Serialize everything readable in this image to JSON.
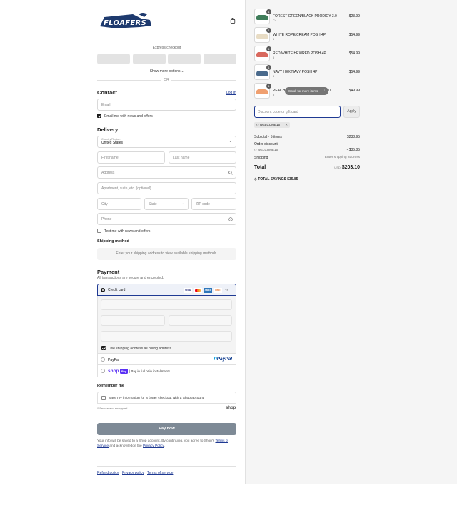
{
  "brand": {
    "name": "FLOAFERS"
  },
  "express": {
    "label": "Express checkout",
    "show_more": "Show more options",
    "or": "OR"
  },
  "contact": {
    "title": "Contact",
    "login": "Log in",
    "email_placeholder": "Email",
    "email_news": "Email me with news and offers"
  },
  "delivery": {
    "title": "Delivery",
    "country_label": "Country/Region",
    "country_value": "United States",
    "first_name": "First name",
    "last_name": "Last name",
    "address": "Address",
    "apartment": "Apartment, suite, etc. (optional)",
    "city": "City",
    "state": "State",
    "zip": "ZIP code",
    "phone": "Phone",
    "text_news": "Text me with news and offers"
  },
  "shipping": {
    "title": "Shipping method",
    "message": "Enter your shipping address to view available shipping methods."
  },
  "payment": {
    "title": "Payment",
    "subtitle": "All transactions are secure and encrypted.",
    "credit_card": "Credit card",
    "card_brands": [
      "VISA",
      "MC",
      "AMEX",
      "DISC"
    ],
    "more_brands": "+4",
    "billing_same": "Use shipping address as billing address",
    "paypal": "PayPal",
    "paypal_logo": "PayPal",
    "shoppay_logo": "shop",
    "shoppay_badge": "Pay",
    "shoppay_text": "| Pay in full or in installments"
  },
  "remember": {
    "title": "Remember me",
    "save_info": "Save my information for a faster checkout with a Shop account",
    "secure": "Secure and encrypted",
    "shop": "shop"
  },
  "pay_now": "Pay now",
  "legal": {
    "prefix": "Your info will be saved to a Shop account. By continuing, you agree to Shop's ",
    "terms": "Terms of Service",
    "middle": " and acknowledge the ",
    "privacy": "Privacy Policy",
    "suffix": "."
  },
  "footer": {
    "refund": "Refund policy",
    "privacy": "Privacy policy",
    "terms": "Terms of service"
  },
  "cart": {
    "items": [
      {
        "name": "FOREST GREEN/BLACK PRODIGY 3.0",
        "variant": "C4",
        "qty": "1",
        "price": "$23.99",
        "color": "#3f7d5a"
      },
      {
        "name": "WHITE ROPE/CREAM POSH 4P",
        "variant": "5",
        "qty": "1",
        "price": "$54.99",
        "color": "#e8dcc4"
      },
      {
        "name": "RED WHITE HEX/RED POSH 4P",
        "variant": "5",
        "qty": "1",
        "price": "$54.99",
        "color": "#d9695e"
      },
      {
        "name": "NAVY HEX/NAVY POSH 4P",
        "variant": "5",
        "qty": "1",
        "price": "$54.99",
        "color": "#4a6a8c"
      },
      {
        "name": "PEACH",
        "name_tail": "0",
        "variant": "5",
        "qty": "1",
        "price": "$49.99",
        "color": "#f0a070"
      }
    ],
    "scroll_hint": "Scroll for more items",
    "discount_placeholder": "Discount code or gift card",
    "apply": "Apply",
    "code_chip": "WELCOME15",
    "subtotal_label": "Subtotal · 5 items",
    "subtotal": "$238.95",
    "order_discount_label": "Order discount",
    "discount_code": "WELCOME15",
    "discount_value": "- $35.85",
    "shipping_label": "Shipping",
    "shipping_value": "Enter shipping address",
    "total_label": "Total",
    "currency": "USD",
    "total": "$203.10",
    "savings_label": "TOTAL SAVINGS",
    "savings": "$35.85"
  },
  "colors": {
    "accent": "#1f3a93",
    "logo": "#1e3a6e",
    "pay_button": "#7e8a96"
  }
}
